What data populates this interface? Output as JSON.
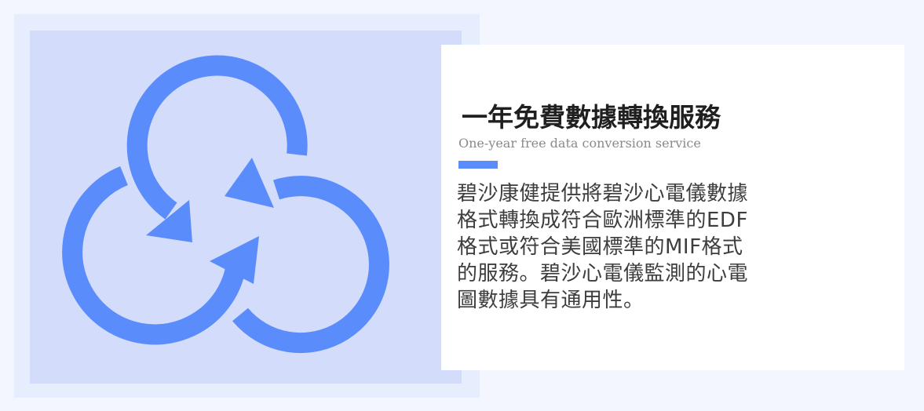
{
  "heading": {
    "title": "一年免費數據轉換服務",
    "subtitle": "One-year free data conversion service"
  },
  "description": {
    "lines": [
      "碧沙康健提供將碧沙心電儀數據",
      "格式轉換成符合歐洲標準的EDF",
      "格式或符合美國標準的MIF格式",
      "的服務。碧沙心電儀監測的心電",
      "圖數據具有通用性。"
    ]
  },
  "colors": {
    "accent": "#5b8cfc",
    "page_background": "#f3f6fe",
    "illustration_background": "#d3ddfb",
    "card_background": "#ffffff"
  },
  "illustration": {
    "icon": "three-circular-arrows-conversion-icon"
  }
}
